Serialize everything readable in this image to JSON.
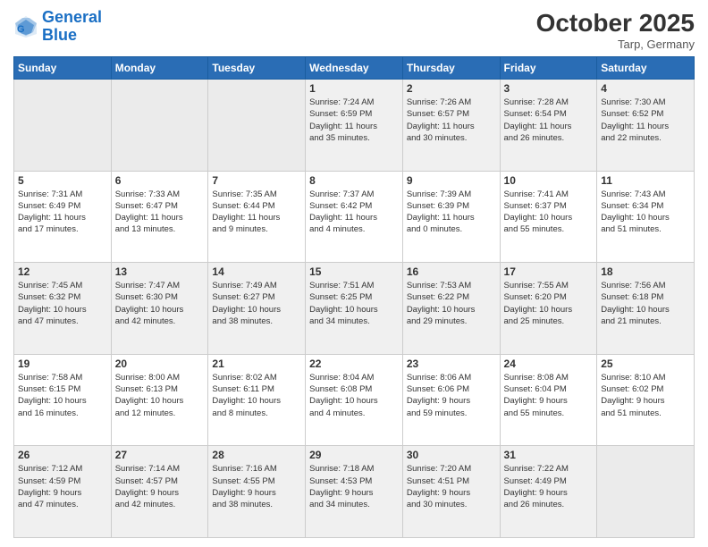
{
  "header": {
    "logo_line1": "General",
    "logo_line2": "Blue",
    "month": "October 2025",
    "location": "Tarp, Germany"
  },
  "days_of_week": [
    "Sunday",
    "Monday",
    "Tuesday",
    "Wednesday",
    "Thursday",
    "Friday",
    "Saturday"
  ],
  "weeks": [
    [
      {
        "day": "",
        "info": ""
      },
      {
        "day": "",
        "info": ""
      },
      {
        "day": "",
        "info": ""
      },
      {
        "day": "1",
        "info": "Sunrise: 7:24 AM\nSunset: 6:59 PM\nDaylight: 11 hours\nand 35 minutes."
      },
      {
        "day": "2",
        "info": "Sunrise: 7:26 AM\nSunset: 6:57 PM\nDaylight: 11 hours\nand 30 minutes."
      },
      {
        "day": "3",
        "info": "Sunrise: 7:28 AM\nSunset: 6:54 PM\nDaylight: 11 hours\nand 26 minutes."
      },
      {
        "day": "4",
        "info": "Sunrise: 7:30 AM\nSunset: 6:52 PM\nDaylight: 11 hours\nand 22 minutes."
      }
    ],
    [
      {
        "day": "5",
        "info": "Sunrise: 7:31 AM\nSunset: 6:49 PM\nDaylight: 11 hours\nand 17 minutes."
      },
      {
        "day": "6",
        "info": "Sunrise: 7:33 AM\nSunset: 6:47 PM\nDaylight: 11 hours\nand 13 minutes."
      },
      {
        "day": "7",
        "info": "Sunrise: 7:35 AM\nSunset: 6:44 PM\nDaylight: 11 hours\nand 9 minutes."
      },
      {
        "day": "8",
        "info": "Sunrise: 7:37 AM\nSunset: 6:42 PM\nDaylight: 11 hours\nand 4 minutes."
      },
      {
        "day": "9",
        "info": "Sunrise: 7:39 AM\nSunset: 6:39 PM\nDaylight: 11 hours\nand 0 minutes."
      },
      {
        "day": "10",
        "info": "Sunrise: 7:41 AM\nSunset: 6:37 PM\nDaylight: 10 hours\nand 55 minutes."
      },
      {
        "day": "11",
        "info": "Sunrise: 7:43 AM\nSunset: 6:34 PM\nDaylight: 10 hours\nand 51 minutes."
      }
    ],
    [
      {
        "day": "12",
        "info": "Sunrise: 7:45 AM\nSunset: 6:32 PM\nDaylight: 10 hours\nand 47 minutes."
      },
      {
        "day": "13",
        "info": "Sunrise: 7:47 AM\nSunset: 6:30 PM\nDaylight: 10 hours\nand 42 minutes."
      },
      {
        "day": "14",
        "info": "Sunrise: 7:49 AM\nSunset: 6:27 PM\nDaylight: 10 hours\nand 38 minutes."
      },
      {
        "day": "15",
        "info": "Sunrise: 7:51 AM\nSunset: 6:25 PM\nDaylight: 10 hours\nand 34 minutes."
      },
      {
        "day": "16",
        "info": "Sunrise: 7:53 AM\nSunset: 6:22 PM\nDaylight: 10 hours\nand 29 minutes."
      },
      {
        "day": "17",
        "info": "Sunrise: 7:55 AM\nSunset: 6:20 PM\nDaylight: 10 hours\nand 25 minutes."
      },
      {
        "day": "18",
        "info": "Sunrise: 7:56 AM\nSunset: 6:18 PM\nDaylight: 10 hours\nand 21 minutes."
      }
    ],
    [
      {
        "day": "19",
        "info": "Sunrise: 7:58 AM\nSunset: 6:15 PM\nDaylight: 10 hours\nand 16 minutes."
      },
      {
        "day": "20",
        "info": "Sunrise: 8:00 AM\nSunset: 6:13 PM\nDaylight: 10 hours\nand 12 minutes."
      },
      {
        "day": "21",
        "info": "Sunrise: 8:02 AM\nSunset: 6:11 PM\nDaylight: 10 hours\nand 8 minutes."
      },
      {
        "day": "22",
        "info": "Sunrise: 8:04 AM\nSunset: 6:08 PM\nDaylight: 10 hours\nand 4 minutes."
      },
      {
        "day": "23",
        "info": "Sunrise: 8:06 AM\nSunset: 6:06 PM\nDaylight: 9 hours\nand 59 minutes."
      },
      {
        "day": "24",
        "info": "Sunrise: 8:08 AM\nSunset: 6:04 PM\nDaylight: 9 hours\nand 55 minutes."
      },
      {
        "day": "25",
        "info": "Sunrise: 8:10 AM\nSunset: 6:02 PM\nDaylight: 9 hours\nand 51 minutes."
      }
    ],
    [
      {
        "day": "26",
        "info": "Sunrise: 7:12 AM\nSunset: 4:59 PM\nDaylight: 9 hours\nand 47 minutes."
      },
      {
        "day": "27",
        "info": "Sunrise: 7:14 AM\nSunset: 4:57 PM\nDaylight: 9 hours\nand 42 minutes."
      },
      {
        "day": "28",
        "info": "Sunrise: 7:16 AM\nSunset: 4:55 PM\nDaylight: 9 hours\nand 38 minutes."
      },
      {
        "day": "29",
        "info": "Sunrise: 7:18 AM\nSunset: 4:53 PM\nDaylight: 9 hours\nand 34 minutes."
      },
      {
        "day": "30",
        "info": "Sunrise: 7:20 AM\nSunset: 4:51 PM\nDaylight: 9 hours\nand 30 minutes."
      },
      {
        "day": "31",
        "info": "Sunrise: 7:22 AM\nSunset: 4:49 PM\nDaylight: 9 hours\nand 26 minutes."
      },
      {
        "day": "",
        "info": ""
      }
    ]
  ]
}
